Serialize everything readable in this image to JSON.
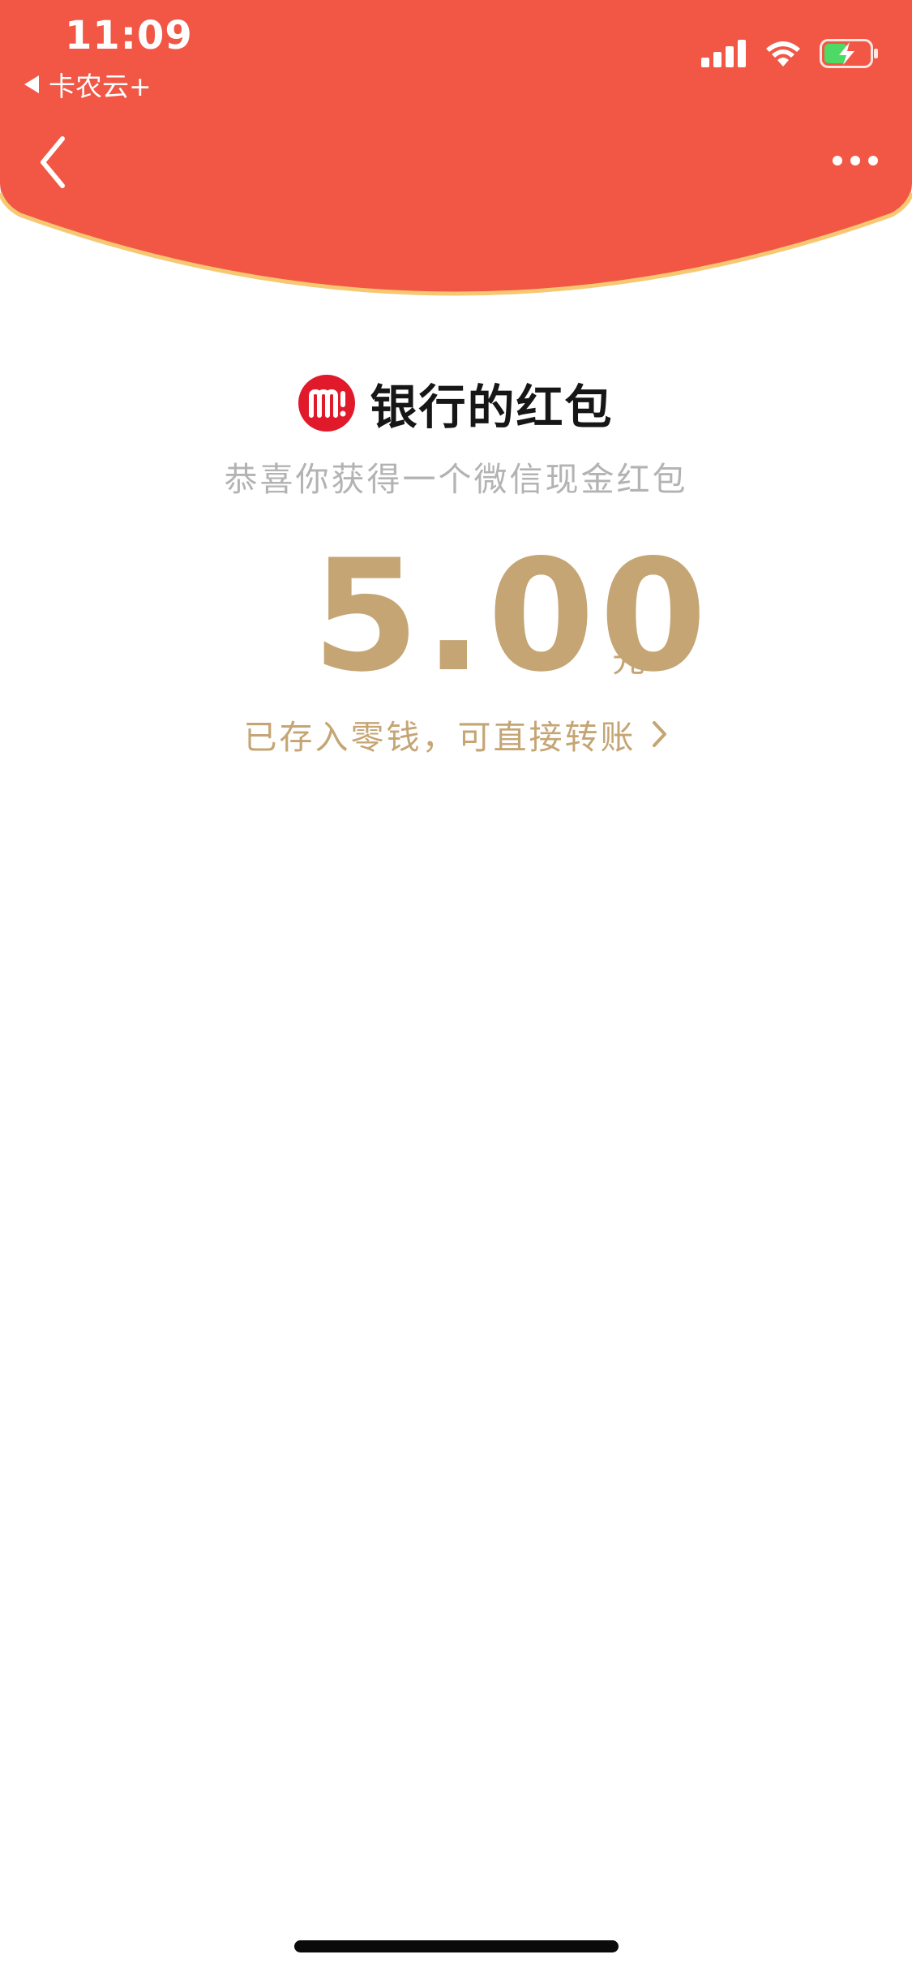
{
  "status_bar": {
    "time": "11:09",
    "back_app_label": "卡农云+"
  },
  "header": {
    "color": "#f25745",
    "edge_color": "#f7c872"
  },
  "packet": {
    "sender_title": "银行的红包",
    "logo_color": "#e0192b",
    "subtitle": "恭喜你获得一个微信现金红包",
    "amount": "5.00",
    "unit": "元",
    "balance_link": "已存入零钱，可直接转账"
  },
  "icons": {
    "back": "chevron-left-icon",
    "more": "more-dots-icon",
    "signal": "signal-icon",
    "wifi": "wifi-icon",
    "battery": "battery-charging-icon",
    "link_chevron": "chevron-right-icon"
  }
}
